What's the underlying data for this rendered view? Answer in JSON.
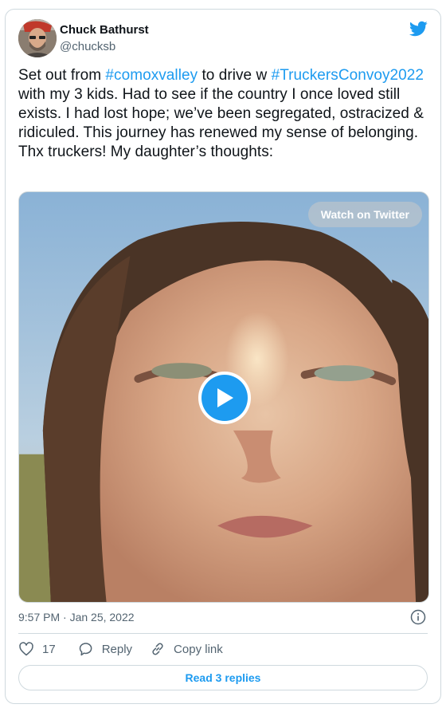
{
  "author": {
    "display_name": "Chuck Bathurst",
    "handle": "@chucksb"
  },
  "tweet": {
    "text_parts": [
      {
        "text": "Set out from ",
        "type": "text"
      },
      {
        "text": "#comoxvalley",
        "type": "hashtag"
      },
      {
        "text": " to drive w ",
        "type": "text"
      },
      {
        "text": "#TruckersConvoy2022",
        "type": "hashtag"
      },
      {
        "text": " with my 3 kids. Had to see if the country I once loved still exists. I had lost hope; we’ve been segregated, ostracized & ridiculed. This journey has renewed my sense of belonging. Thx truckers! My daughter’s thoughts:",
        "type": "text"
      }
    ],
    "timestamp": "9:57 PM · Jan 25, 2022"
  },
  "media": {
    "watch_label": "Watch on Twitter"
  },
  "actions": {
    "likes_count": "17",
    "reply_label": "Reply",
    "copy_link_label": "Copy link",
    "read_replies_label": "Read 3 replies"
  },
  "icons": {
    "brand": "twitter-bird-icon",
    "like": "heart-icon",
    "reply": "speech-bubble-icon",
    "copy": "link-icon",
    "info": "info-icon",
    "play": "play-icon"
  },
  "colors": {
    "accent": "#1d9bf0",
    "muted_text": "#536471",
    "border": "#cfd9de"
  }
}
